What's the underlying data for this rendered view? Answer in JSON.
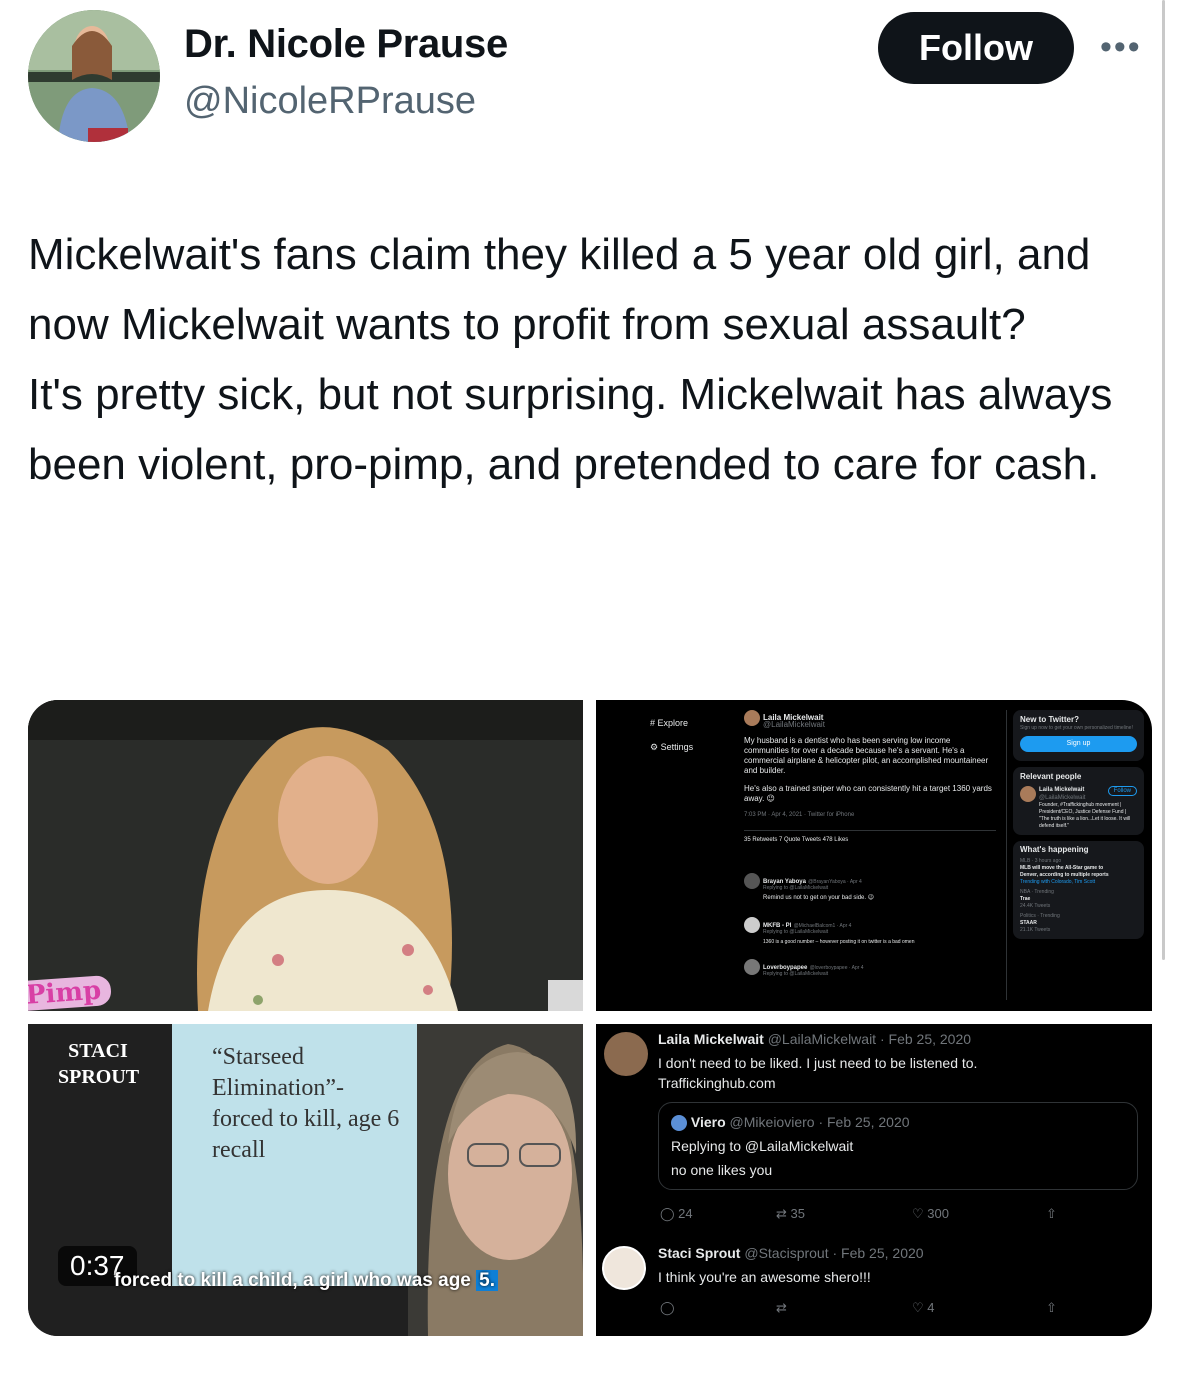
{
  "author": {
    "name": "Dr. Nicole Prause",
    "handle": "@NicoleRPrause",
    "follow_label": "Follow",
    "more_label": "•••"
  },
  "tweet": {
    "lines": [
      "Mickelwait's fans claim they killed a 5 year old girl, and now Mickelwait wants to profit from sexual assault?",
      "It's pretty sick, but not surprising. Mickelwait has always been violent, pro-pimp, and pretended to care for cash."
    ]
  },
  "media": {
    "image1": {
      "badge": "Pimp"
    },
    "image2": {
      "nav": [
        "Explore",
        "Settings"
      ],
      "post_author": "Laila Mickelwait",
      "post_handle": "@LailaMickelwait",
      "post_text1": "My husband is a dentist who has been serving low income communities for over a decade because he's a servant. He's a commercial airplane & helicopter pilot, an accomplished mountaineer and builder.",
      "post_text2": "He's also a trained sniper who can consistently hit a target 1360 yards away. 😉",
      "post_meta": "7:03 PM · Apr 4, 2021 · Twitter for iPhone",
      "post_stats": "35 Retweets   7 Quote Tweets   478 Likes",
      "reply1_author": "Brayan Yaboya",
      "reply1_meta": "@BrayanYaboya · Apr 4",
      "reply1_to": "Replying to @LailaMickelwait",
      "reply1_text": "Remind us not to get on your bad side. 😉",
      "reply2_author": "MKFB - PI",
      "reply2_meta": "@MichaelBalcom1 · Apr 4",
      "reply2_to": "Replying to @LailaMickelwait",
      "reply2_text": "1360 is a good number – however posting it on twitter is a bad omen",
      "reply3_author": "Loverboypapee",
      "reply3_meta": "@loverboypapee · Apr 4",
      "reply3_to": "Replying to @LailaMickelwait",
      "side_new": "New to Twitter?",
      "side_new_sub": "Sign up now to get your own personalized timeline!",
      "side_signup": "Sign up",
      "side_relevant": "Relevant people",
      "side_person": "Laila Mickelwait",
      "side_person_handle": "@LailaMickelwait",
      "side_follow": "Follow",
      "side_bio": "Founder, #Traffickinghub movement | President/CEO, Justice Defense Fund | \"The truth is like a lion...Let it loose. It will defend itself.\"",
      "side_happening": "What's happening",
      "trend1_meta": "MLB · 3 hours ago",
      "trend1": "MLB will move the All-Star game to Denver, according to multiple reports",
      "trend1_sub": "Trending with Colorado, Tim Scott",
      "trend2_meta": "NBA · Trending",
      "trend2": "Trae",
      "trend2_sub": "24.4K Tweets",
      "trend3_meta": "Politics · Trending",
      "trend3": "STAAR",
      "trend3_sub": "21.1K Tweets"
    },
    "image3": {
      "name_label": "STACI SPROUT",
      "card_text": "“Starseed Elimination”- forced to kill, age 6 recall",
      "timer": "0:37",
      "caption_main": "forced to kill a child, a girl who was age ",
      "caption_hl": "5."
    },
    "image4": {
      "tweet1_author": "Laila Mickelwait",
      "tweet1_meta": "@LailaMickelwait · Feb 25, 2020",
      "tweet1_text": "I don't need to be liked. I just need to be listened to.",
      "tweet1_link": "Traffickinghub.com",
      "quote_author": "Viero",
      "quote_meta": "@Mikeioviero · Feb 25, 2020",
      "quote_to": "Replying to @LailaMickelwait",
      "quote_text": "no one likes you",
      "stat_replies": "24",
      "stat_retweets": "35",
      "stat_likes": "300",
      "tweet2_author": "Staci Sprout",
      "tweet2_meta": "@Stacisprout · Feb 25, 2020",
      "tweet2_text": "I think you're an awesome shero!!!",
      "tweet2_likes": "4"
    }
  },
  "colors": {
    "follow_bg": "#0f1419",
    "link": "#1d9bf0",
    "muted": "#536471"
  }
}
